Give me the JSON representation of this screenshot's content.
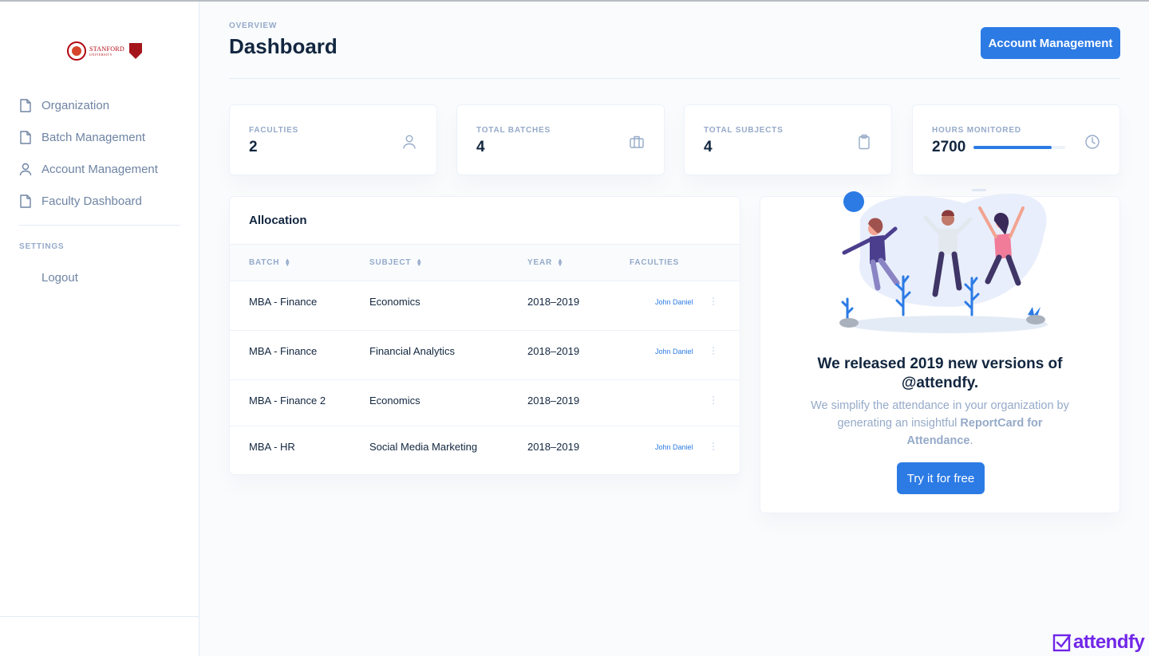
{
  "app": {
    "logo_text": "STANFORD",
    "logo_subtext": "UNIVERSITY",
    "brand": "attendfy"
  },
  "sidebar": {
    "items": [
      {
        "label": "Organization",
        "icon": "file-icon"
      },
      {
        "label": "Batch Management",
        "icon": "file-icon"
      },
      {
        "label": "Account Management",
        "icon": "user-icon"
      },
      {
        "label": "Faculty Dashboard",
        "icon": "file-icon"
      }
    ],
    "settings_label": "SETTINGS",
    "logout_label": "Logout"
  },
  "header": {
    "pretitle": "OVERVIEW",
    "title": "Dashboard",
    "account_button": "Account Management"
  },
  "stats": [
    {
      "label": "FACULTIES",
      "value": "2",
      "icon": "user-icon"
    },
    {
      "label": "TOTAL BATCHES",
      "value": "4",
      "icon": "briefcase-icon"
    },
    {
      "label": "TOTAL SUBJECTS",
      "value": "4",
      "icon": "clipboard-icon"
    },
    {
      "label": "HOURS MONITORED",
      "value": "2700",
      "icon": "clock-icon",
      "progress": 0.85
    }
  ],
  "allocation": {
    "title": "Allocation",
    "columns": [
      "BATCH",
      "SUBJECT",
      "YEAR",
      "FACULTIES"
    ],
    "rows": [
      {
        "batch": "MBA - Finance",
        "subject": "Economics",
        "year": "2018–2019",
        "faculty": "John Daniel"
      },
      {
        "batch": "MBA - Finance",
        "subject": "Financial Analytics",
        "year": "2018–2019",
        "faculty": "John Daniel"
      },
      {
        "batch": "MBA - Finance 2",
        "subject": "Economics",
        "year": "2018–2019",
        "faculty": ""
      },
      {
        "batch": "MBA - HR",
        "subject": "Social Media Marketing",
        "year": "2018–2019",
        "faculty": "John Daniel"
      }
    ]
  },
  "promo": {
    "title": "We released 2019 new versions of @attendfy.",
    "text_before": "We simplify the attendance in your organization by generating an insightful ",
    "text_bold": "ReportCard for Attendance",
    "text_after": ".",
    "button": "Try it for free"
  },
  "colors": {
    "accent": "#2c7be5",
    "brand": "#7026e8",
    "muted": "#95aac9",
    "text": "#12263f"
  }
}
